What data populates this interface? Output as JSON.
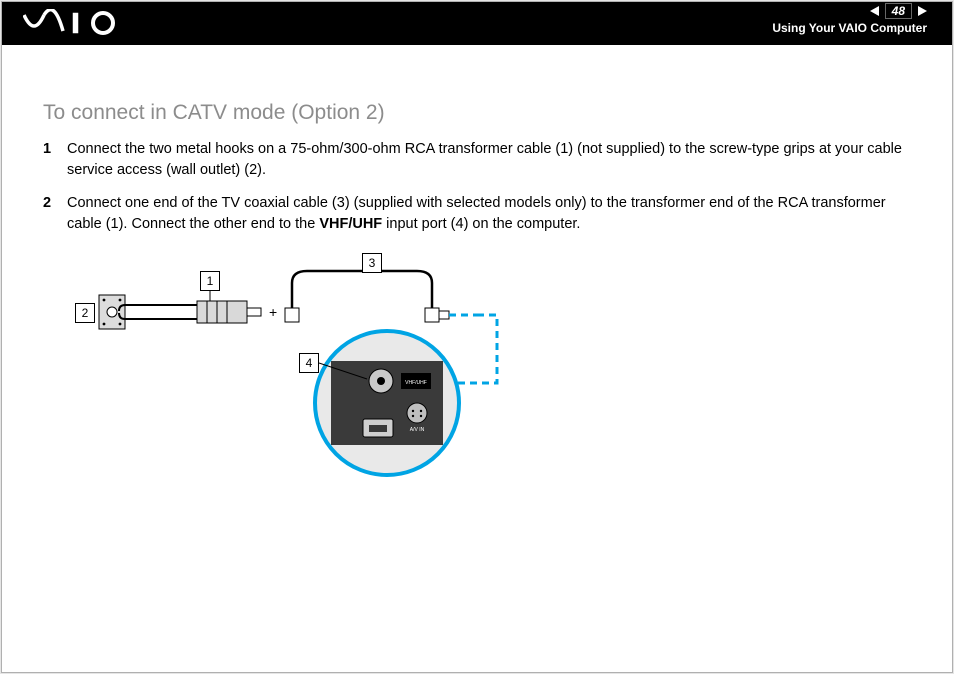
{
  "header": {
    "page_number": "48",
    "section": "Using Your VAIO Computer"
  },
  "content": {
    "heading": "To connect in CATV mode (Option 2)",
    "steps": [
      "Connect the two metal hooks on a 75-ohm/300-ohm RCA transformer cable (1) (not supplied) to the screw-type grips at your cable service access (wall outlet) (2).",
      "Connect one end of the TV coaxial cable (3) (supplied with selected models only) to the transformer end of the RCA transformer cable (1). Connect the other end to the "
    ],
    "step2_bold": "VHF/UHF",
    "step2_tail": " input port (4) on the computer."
  },
  "diagram": {
    "callouts": {
      "c1": "1",
      "c2": "2",
      "c3": "3",
      "c4": "4"
    },
    "labels": {
      "vhf": "VHF/UHF",
      "avin": "A/V IN"
    }
  }
}
